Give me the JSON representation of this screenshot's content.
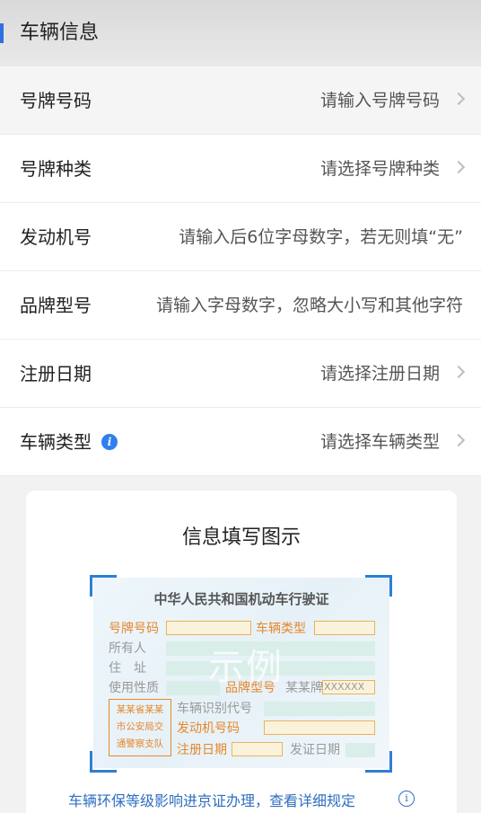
{
  "header": {
    "title": "车辆信息",
    "accent_color": "#2f6fe0"
  },
  "form": {
    "plate_number": {
      "label": "号牌号码",
      "placeholder": "请输入号牌号码",
      "icon": "chevron-right-icon"
    },
    "plate_type": {
      "label": "号牌种类",
      "placeholder": "请选择号牌种类",
      "icon": "chevron-right-icon"
    },
    "engine_number": {
      "label": "发动机号",
      "placeholder": "请输入后6位字母数字，若无则填“无”"
    },
    "brand_model": {
      "label": "品牌型号",
      "placeholder": "请输入字母数字，忽略大小写和其他字符"
    },
    "register_date": {
      "label": "注册日期",
      "placeholder": "请选择注册日期",
      "icon": "chevron-right-icon"
    },
    "vehicle_type": {
      "label": "车辆类型",
      "placeholder": "请选择车辆类型",
      "info_icon": "info-icon",
      "icon": "chevron-right-icon"
    }
  },
  "guide": {
    "title": "信息填写图示",
    "license": {
      "title": "中华人民共和国机动车行驶证",
      "plate_number": "号牌号码",
      "vehicle_type": "车辆类型",
      "owner": "所有人",
      "address": "住　址",
      "use_nature": "使用性质",
      "brand_model": "品牌型号",
      "brand_sample": "某某牌",
      "model_sample": "XXXXXX",
      "vin": "车辆识别代号",
      "engine_number": "发动机号码",
      "register_date": "注册日期",
      "issue_date": "发证日期",
      "stamp": [
        "某某省某某",
        "市公安局交",
        "通警察支队"
      ],
      "watermark": "示例"
    }
  },
  "notice": {
    "text": "车辆环保等级影响进京证办理，查看详细规定",
    "icon": "info-circle-icon",
    "color": "#2f6fbf"
  }
}
